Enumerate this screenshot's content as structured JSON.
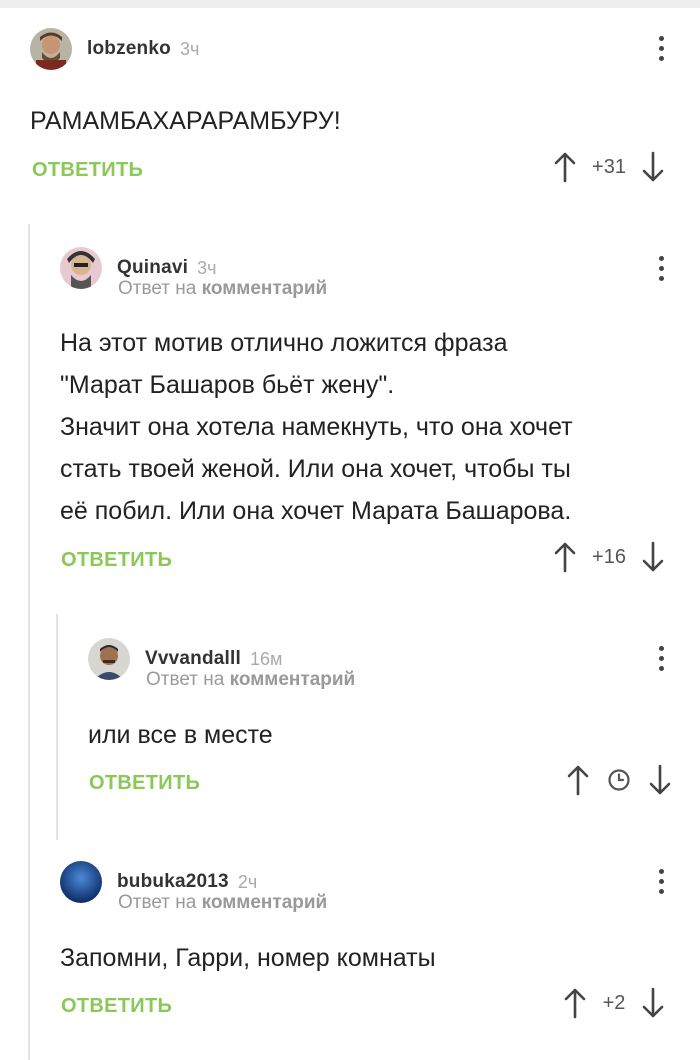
{
  "comments": [
    {
      "author": "lobzenko",
      "time": "3ч",
      "text": "РАМАМБАХАРАРАМБУРУ!",
      "reply_label": "ОТВЕТИТЬ",
      "score": "+31",
      "avatar_color": "#7a4b2a"
    },
    {
      "author": "Quinavi",
      "time": "3ч",
      "reply_to_prefix": "Ответ на",
      "reply_to_target": "комментарий",
      "text_lines": [
        "На этот мотив отлично ложится фраза",
        "\"Марат Башаров бьёт жену\".",
        "Значит она хотела намекнуть, что она хочет",
        "стать твоей женой. Или она хочет, чтобы ты",
        "её побил. Или она хочет Марата Башарова."
      ],
      "reply_label": "ОТВЕТИТЬ",
      "score": "+16",
      "avatar_color": "#c9a0a8"
    },
    {
      "author": "Vvvandalll",
      "time": "16м",
      "reply_to_prefix": "Ответ на",
      "reply_to_target": "комментарий",
      "text": "или все в месте",
      "reply_label": "ОТВЕТИТЬ",
      "score_icon": "clock-icon",
      "avatar_color": "#8a6a4a"
    },
    {
      "author": "bubuka2013",
      "time": "2ч",
      "reply_to_prefix": "Ответ на",
      "reply_to_target": "комментарий",
      "text": "Запомни, Гарри, номер комнаты",
      "reply_label": "ОТВЕТИТЬ",
      "score": "+2",
      "avatar_color": "#1d4fa0"
    }
  ],
  "colors": {
    "accent_green": "#8ac858",
    "thread_line": "#e3e3e3",
    "muted": "#aaaaaa"
  }
}
